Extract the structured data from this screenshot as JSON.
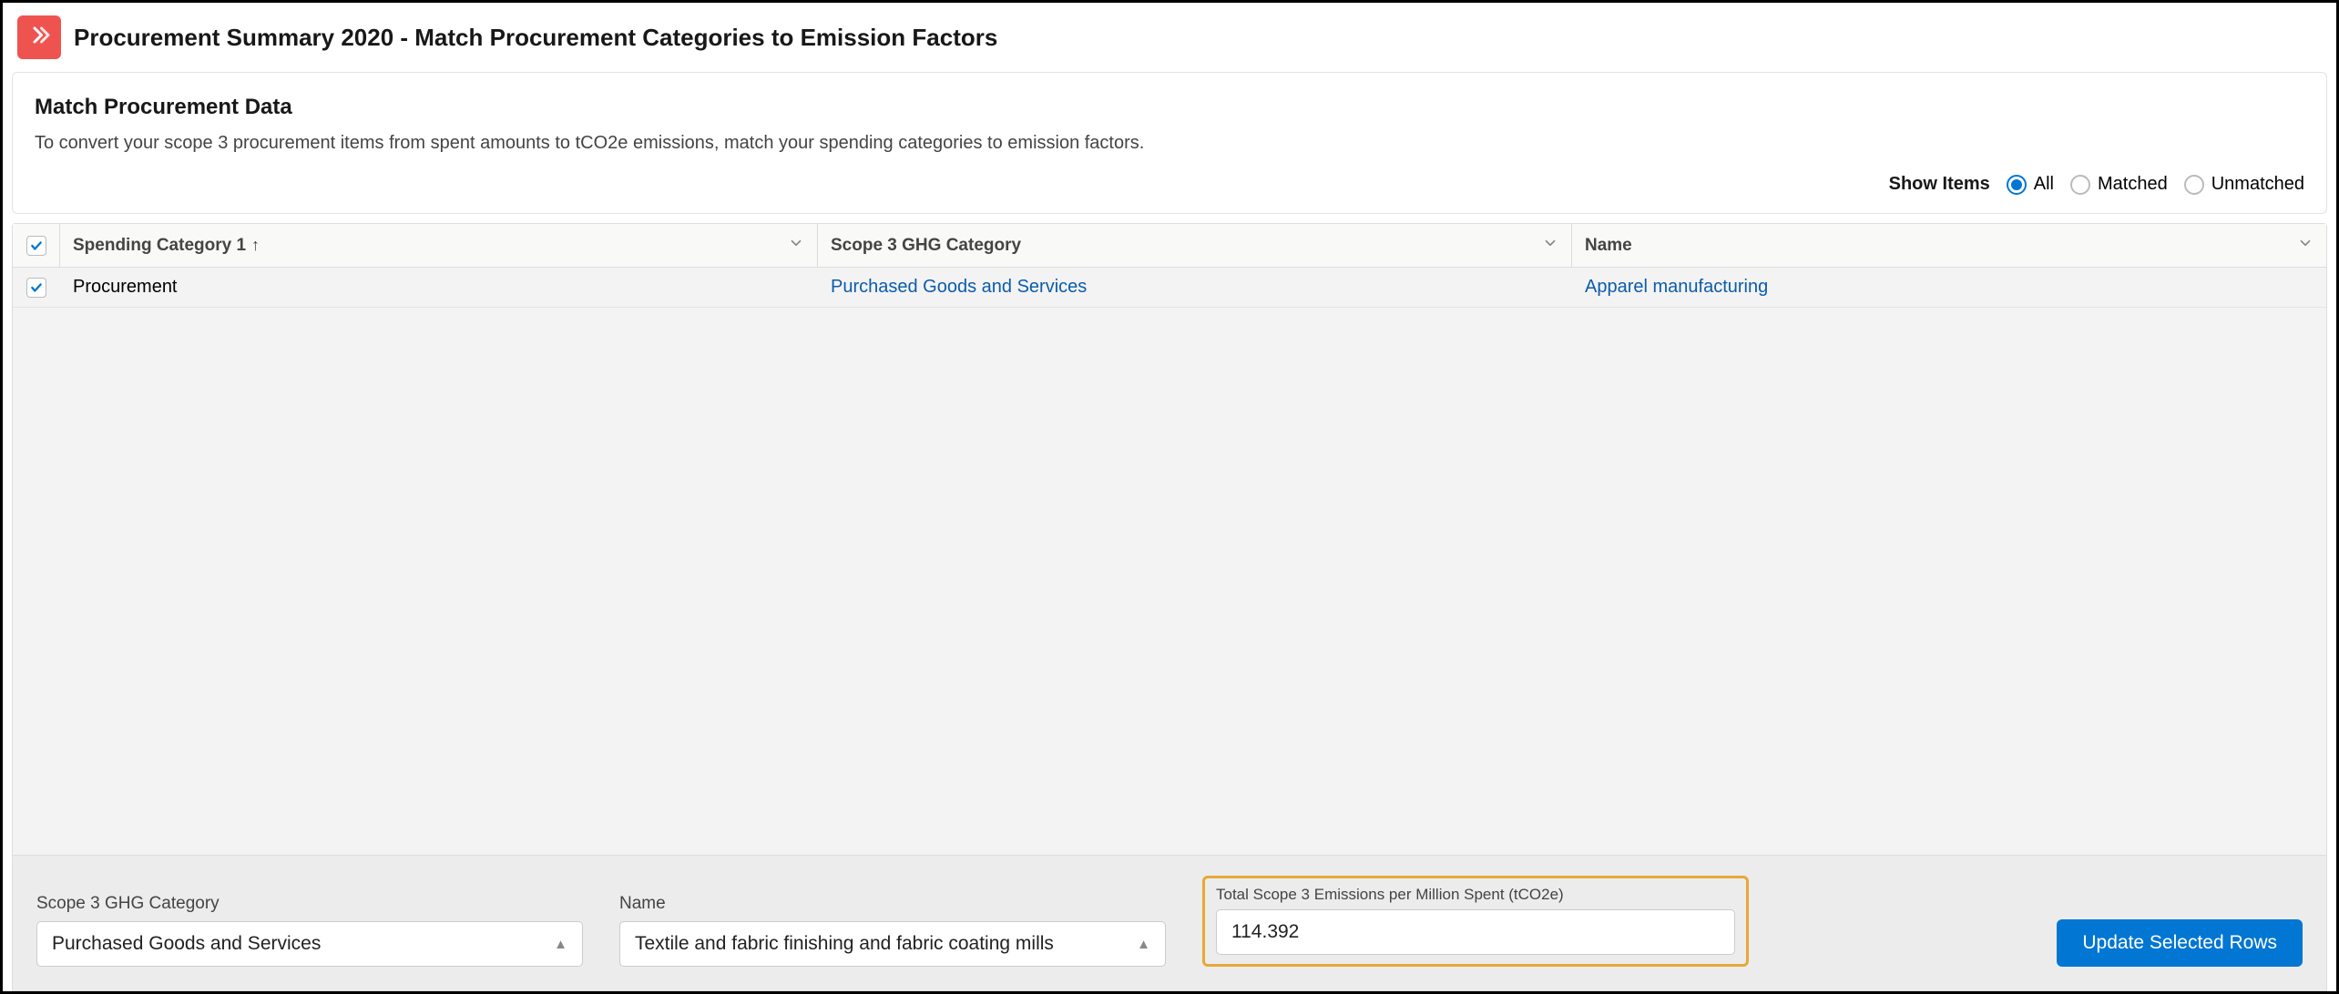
{
  "header": {
    "title": "Procurement Summary 2020 - Match Procurement Categories to Emission Factors"
  },
  "card": {
    "title": "Match Procurement Data",
    "description": "To convert your scope 3 procurement items from spent amounts to tCO2e emissions, match your spending categories to emission factors."
  },
  "filter": {
    "label": "Show Items",
    "options": {
      "all": "All",
      "matched": "Matched",
      "unmatched": "Unmatched"
    },
    "selected": "all"
  },
  "table": {
    "columns": {
      "spending": "Spending Category 1",
      "ghg": "Scope 3 GHG Category",
      "name": "Name"
    },
    "rows": [
      {
        "spending": "Procurement",
        "ghg": "Purchased Goods and Services",
        "name": "Apparel manufacturing"
      }
    ]
  },
  "footer": {
    "ghgLabel": "Scope 3 GHG Category",
    "ghgValue": "Purchased Goods and Services",
    "nameLabel": "Name",
    "nameValue": "Textile and fabric finishing and fabric coating mills",
    "emissionsLabel": "Total Scope 3 Emissions per Million Spent (tCO2e)",
    "emissionsValue": "114.392",
    "button": "Update Selected Rows"
  }
}
